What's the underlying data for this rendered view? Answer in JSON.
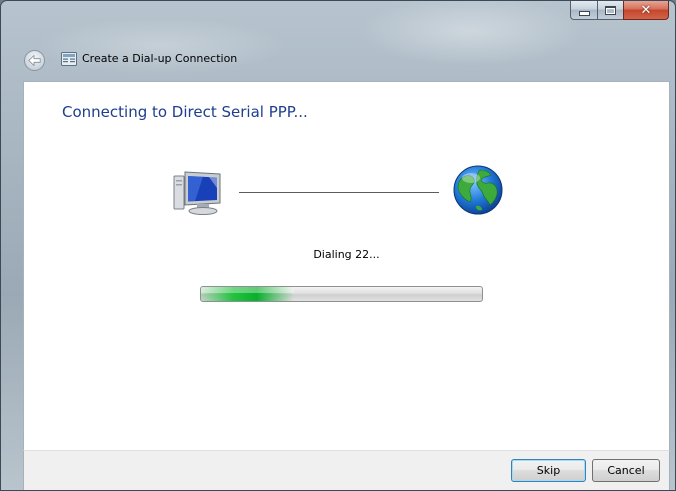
{
  "window": {
    "title": "Create a Dial-up Connection",
    "icons": {
      "back": "back-arrow-icon",
      "app": "dial-up-connection-icon",
      "minimize": "minimize-icon",
      "maximize": "maximize-icon",
      "close": "close-icon"
    },
    "close_glyph": "✕"
  },
  "main": {
    "heading": "Connecting to Direct Serial PPP...",
    "status": "Dialing 22...",
    "progress_fraction": 0.33,
    "icons": {
      "computer": "computer-icon",
      "globe": "globe-icon"
    },
    "colors": {
      "heading": "#1e3e8f",
      "progress": "#22c240"
    }
  },
  "footer": {
    "skip_label": "Skip",
    "cancel_label": "Cancel"
  }
}
